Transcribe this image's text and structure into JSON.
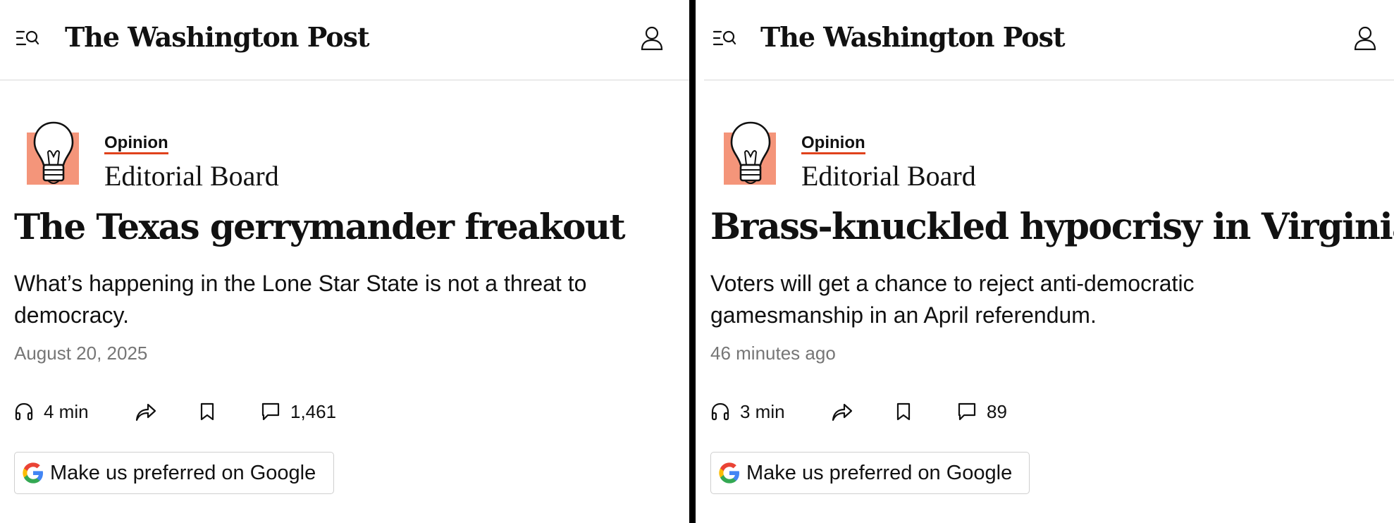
{
  "brand": {
    "logo_text": "The Washington Post",
    "accent": "#e0421c",
    "bulb_bg": "#f4957a"
  },
  "icons": {
    "menu": "menu-search-icon",
    "account": "user-icon",
    "listen": "headphones-icon",
    "share": "share-icon",
    "save": "bookmark-icon",
    "comments": "comment-icon",
    "google": "google-g-icon"
  },
  "panels": [
    {
      "section": "Opinion",
      "author": "Editorial Board",
      "headline": "The Texas gerrymander freakout",
      "dek": "What’s happening in the Lone Star State is not a threat to democracy.",
      "timestamp": "August 20, 2025",
      "listen_time": "4 min",
      "comment_count": "1,461",
      "google_cta": "Make us preferred on Google"
    },
    {
      "section": "Opinion",
      "author": "Editorial Board",
      "headline": "Brass-knuckled hypocrisy in Virginia",
      "dek": "Voters will get a chance to reject anti-democratic gamesmanship in an April referendum.",
      "timestamp": "46 minutes ago",
      "listen_time": "3 min",
      "comment_count": "89",
      "google_cta": "Make us preferred on Google"
    }
  ]
}
